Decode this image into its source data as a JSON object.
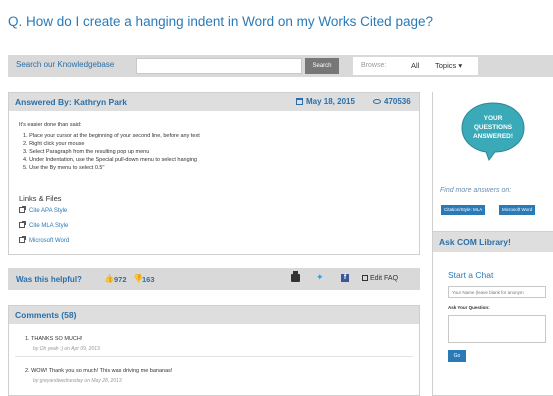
{
  "page": {
    "title": "Q. How do I create a hanging indent in Word on my Works Cited page?"
  },
  "search": {
    "label": "Search our Knowledgebase",
    "placeholder": "",
    "button_label": "Search",
    "browse_label": "Browse:",
    "browse_all": "All",
    "browse_topics": "Topics ▾"
  },
  "answer": {
    "answered_by": "Answered By: Kathryn Park",
    "date": "May 18, 2015",
    "views": "470536",
    "intro": "It's easier done than said:",
    "steps": [
      "1. Place your cursor at the beginning of your second line, before any text",
      "2. Right click your mouse",
      "3. Select Paragraph from the resulting pop up menu",
      "4. Under Indentation, use the Special pull-down menu to select hanging",
      "5. Use the By menu to select 0.5\""
    ],
    "links_heading": "Links & Files",
    "links": [
      "Cite APA Style",
      "Cite MLA Style",
      "Microsoft Word"
    ]
  },
  "helpful": {
    "label": "Was this helpful?",
    "yes_count": "972",
    "no_count": "163",
    "edit_label": "Edit FAQ"
  },
  "comments": {
    "title": "Comments (58)",
    "items": [
      {
        "text": "1. THANKS SO MUCH!",
        "meta": "by Oh yeah :) on Apr 09, 2013"
      },
      {
        "text": "2. WOW! Thank you so much! This was driving me bananas!",
        "meta": "by greyandwednesday on May 28, 2013"
      }
    ]
  },
  "sidebar": {
    "promo_lines": [
      "YOUR",
      "QUESTIONS",
      "ANSWERED!"
    ],
    "find_more": "Find more answers on:",
    "tags": [
      "Citation/Style: MLA",
      "Microsoft Word"
    ],
    "ask_title": "Ask COM Library!",
    "start_chat": "Start a Chat",
    "name_placeholder": "Your Name (leave blank for anonym",
    "question_label": "Ask Your Question:",
    "go_label": "Go"
  },
  "colors": {
    "accent": "#2a7ab8",
    "header_bg": "#dedede",
    "promo_bubble": "#3aaab8"
  }
}
